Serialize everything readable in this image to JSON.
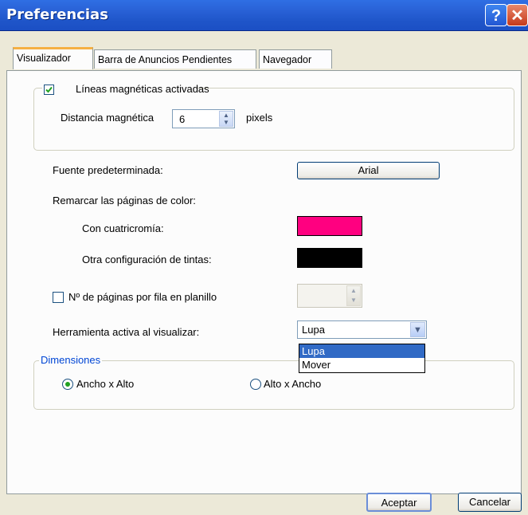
{
  "window": {
    "title": "Preferencias"
  },
  "tabs": [
    {
      "label": "Visualizador",
      "active": true
    },
    {
      "label": "Barra de Anuncios Pendientes",
      "active": false
    },
    {
      "label": "Navegador",
      "active": false
    }
  ],
  "magnetic": {
    "checkbox_label": "Líneas magnéticas activadas",
    "checked": true,
    "distance_label": "Distancia magnética",
    "distance_value": "6",
    "unit": "pixels"
  },
  "font": {
    "label": "Fuente predeterminada:",
    "button": "Arial"
  },
  "highlight": {
    "label": "Remarcar las páginas de color:",
    "cmyk_label": "Con cuatricromía:",
    "cmyk_color": "#ff0080",
    "other_label": "Otra configuración de tintas:",
    "other_color": "#000000"
  },
  "pages_per_row": {
    "label": "Nº de páginas por fila en planillo",
    "checked": false,
    "value": ""
  },
  "tool": {
    "label": "Herramienta activa al visualizar:",
    "selected": "Lupa",
    "options": [
      "Lupa",
      "Mover"
    ]
  },
  "dimensions": {
    "legend": "Dimensiones",
    "option1": "Ancho x Alto",
    "option2": "Alto x Ancho",
    "selected": "Ancho x Alto"
  },
  "buttons": {
    "ok": "Aceptar",
    "cancel": "Cancelar"
  },
  "colors": {
    "title_bar": "#2a63d8",
    "legend_blue": "#0046d5",
    "selection": "#316ac5"
  }
}
